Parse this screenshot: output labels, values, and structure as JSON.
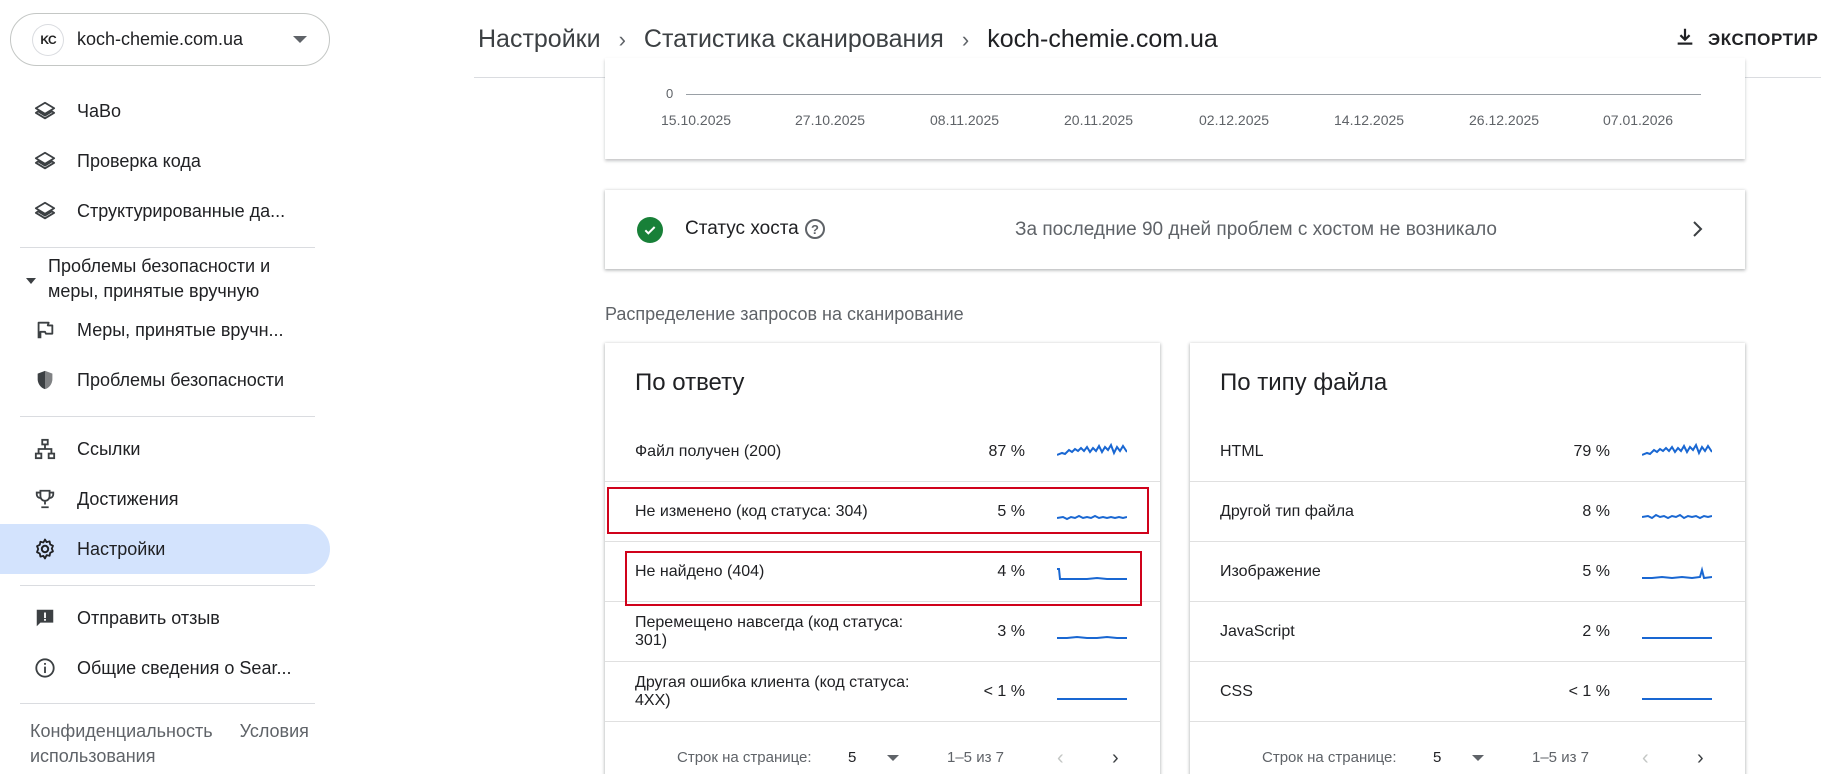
{
  "sidebar": {
    "property": {
      "logo": "KC",
      "name": "koch-chemie.com.ua"
    },
    "items_top": [
      {
        "label": "ЧаВо",
        "icon": "layers-icon"
      },
      {
        "label": "Проверка кода",
        "icon": "layers-icon"
      },
      {
        "label": "Структурированные да...",
        "icon": "layers-icon"
      }
    ],
    "security_section": "Проблемы безопасности и меры, принятые вручную",
    "items_security": [
      {
        "label": "Меры, принятые вручн...",
        "icon": "flag-icon"
      },
      {
        "label": "Проблемы безопасности",
        "icon": "shield-icon"
      }
    ],
    "items_main": [
      {
        "label": "Ссылки",
        "icon": "sitemap-icon"
      },
      {
        "label": "Достижения",
        "icon": "trophy-icon"
      },
      {
        "label": "Настройки",
        "icon": "gear-icon",
        "active": true
      }
    ],
    "items_bottom": [
      {
        "label": "Отправить отзыв",
        "icon": "feedback-icon"
      },
      {
        "label": "Общие сведения о Sear...",
        "icon": "info-icon"
      }
    ],
    "footer": {
      "privacy": "Конфиденциальность",
      "terms": "Условия использования"
    }
  },
  "header": {
    "crumb1": "Настройки",
    "crumb2": "Статистика сканирования",
    "crumb3": "koch-chemie.com.ua",
    "export_label": "ЭКСПОРТИР"
  },
  "chart": {
    "zero_label": "0",
    "x_ticks": [
      "15.10.2025",
      "27.10.2025",
      "08.11.2025",
      "20.11.2025",
      "02.12.2025",
      "14.12.2025",
      "26.12.2025",
      "07.01.2026"
    ]
  },
  "host_status": {
    "title": "Статус хоста",
    "help": "?",
    "description": "За последние 90 дней проблем с хостом не возникало"
  },
  "distribution_title": "Распределение запросов на сканирование",
  "by_response": {
    "title": "По ответу",
    "rows": [
      {
        "label": "Файл получен (200)",
        "pct": "87 %"
      },
      {
        "label": "Не изменено (код статуса: 304)",
        "pct": "5 %"
      },
      {
        "label": "Не найдено (404)",
        "pct": "4 %"
      },
      {
        "label": "Перемещено навсегда (код статуса: 301)",
        "pct": "3 %"
      },
      {
        "label": "Другая ошибка клиента (код статуса: 4XX)",
        "pct": "< 1 %"
      }
    ],
    "pager": {
      "rows_label": "Строк на странице:",
      "rows_value": "5",
      "range": "1–5 из 7"
    }
  },
  "by_filetype": {
    "title": "По типу файла",
    "rows": [
      {
        "label": "HTML",
        "pct": "79 %"
      },
      {
        "label": "Другой тип файла",
        "pct": "8 %"
      },
      {
        "label": "Изображение",
        "pct": "5 %"
      },
      {
        "label": "JavaScript",
        "pct": "2 %"
      },
      {
        "label": "CSS",
        "pct": "< 1 %"
      }
    ],
    "pager": {
      "rows_label": "Строк на странице:",
      "rows_value": "5",
      "range": "1–5 из 7"
    }
  },
  "colors": {
    "accent": "#1967d2",
    "active_nav": "#d3e3fd",
    "ok": "#188038",
    "highlight": "#d0021b"
  }
}
